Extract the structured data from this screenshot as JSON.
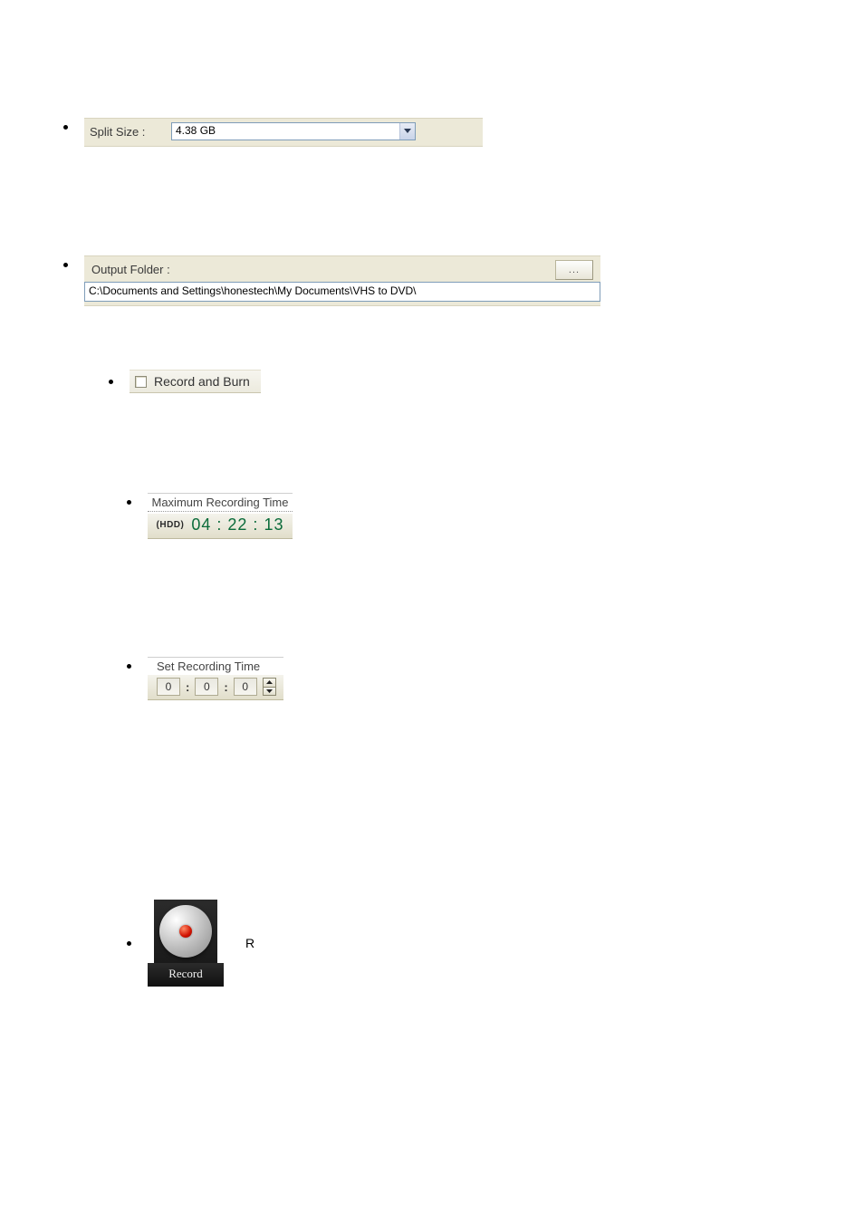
{
  "split_size": {
    "label": "Split Size :",
    "value": "4.38 GB"
  },
  "output_folder": {
    "label": "Output Folder :",
    "browse_label": "...",
    "path": "C:\\Documents and Settings\\honestech\\My Documents\\VHS to DVD\\"
  },
  "record_and_burn": {
    "label": "Record and Burn",
    "checked": false
  },
  "max_recording_time": {
    "title": "Maximum Recording Time",
    "source_label": "(HDD)",
    "hours": "04",
    "minutes": "22",
    "seconds": "13"
  },
  "set_recording_time": {
    "title": "Set Recording Time",
    "hours": "0",
    "minutes": "0",
    "seconds": "0"
  },
  "record_button": {
    "caption": "Record",
    "trailing_text": "R"
  }
}
